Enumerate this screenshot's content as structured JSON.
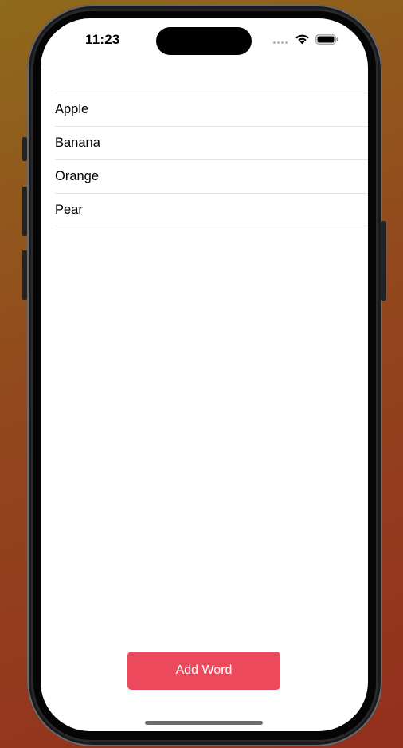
{
  "status_bar": {
    "time": "11:23",
    "wifi_icon": "wifi-icon",
    "battery_icon": "battery-icon"
  },
  "word_list": {
    "items": [
      {
        "label": "Apple"
      },
      {
        "label": "Banana"
      },
      {
        "label": "Orange"
      },
      {
        "label": "Pear"
      }
    ]
  },
  "actions": {
    "add_word_label": "Add Word"
  },
  "colors": {
    "accent": "#ec4a5c",
    "separator": "#e3e3e6",
    "background_top": "#8f6a1b",
    "background_bottom": "#932f1d"
  }
}
